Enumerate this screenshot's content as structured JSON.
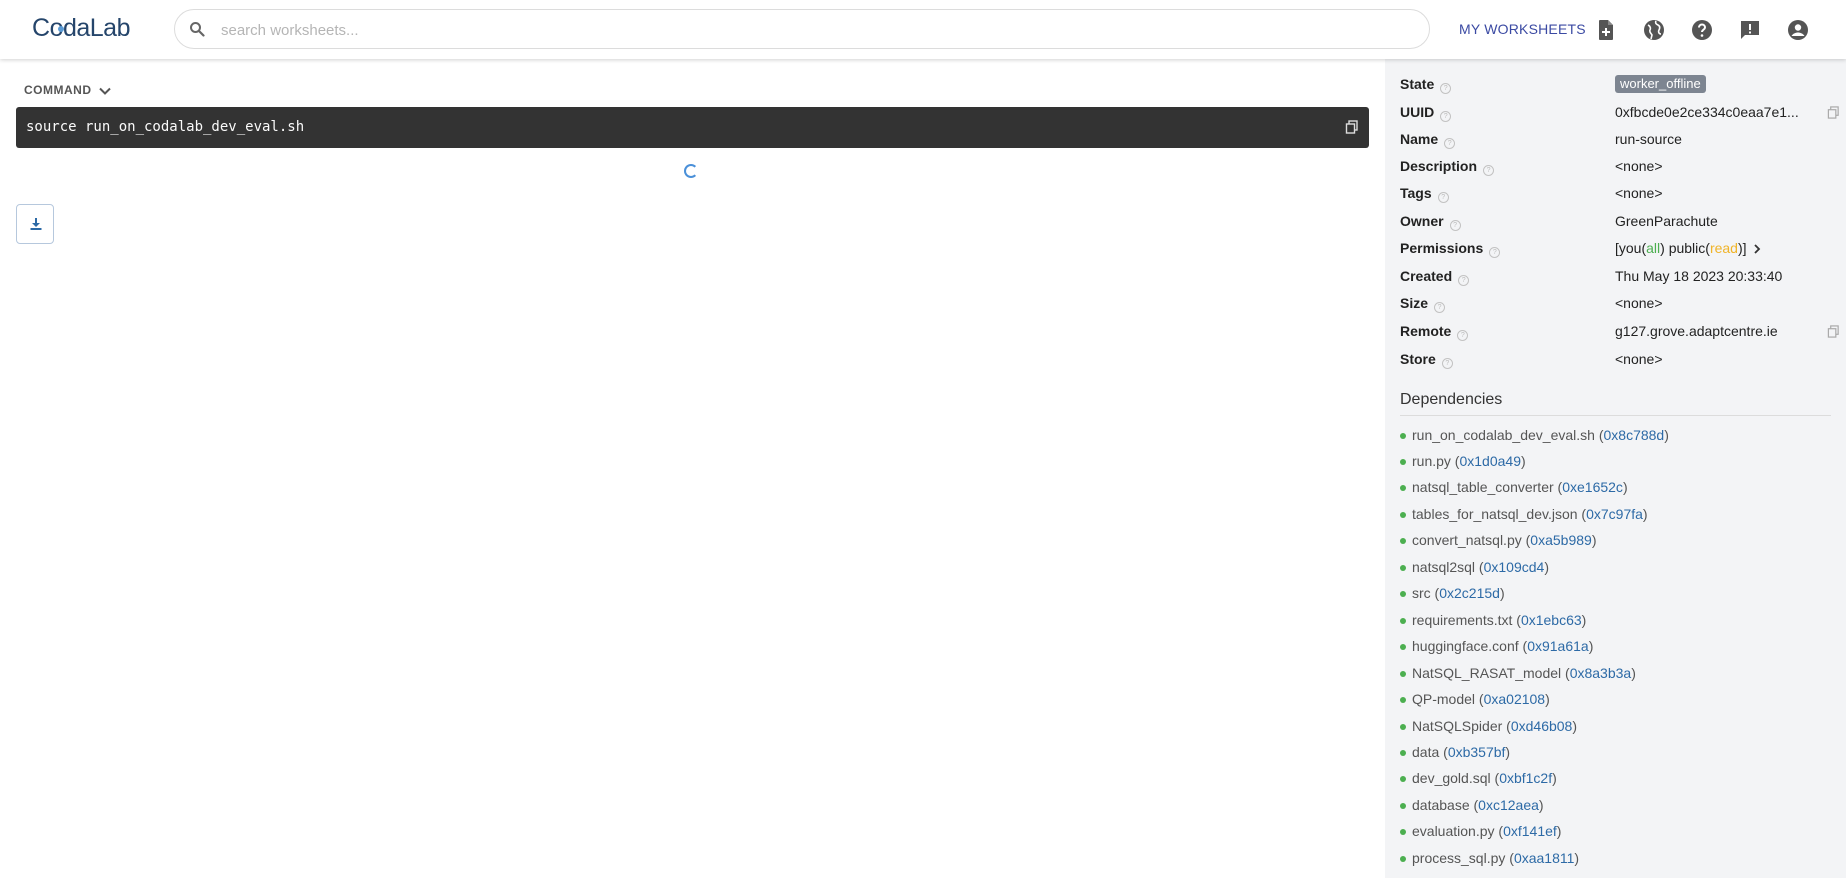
{
  "header": {
    "logo": "CodaLab",
    "search_placeholder": "search worksheets...",
    "my_worksheets": "MY WORKSHEETS",
    "icons": [
      "new-worksheet-icon",
      "globe-icon",
      "help-icon",
      "feedback-icon",
      "account-icon"
    ]
  },
  "main": {
    "command_label": "COMMAND",
    "command": "source run_on_codalab_dev_eval.sh"
  },
  "side": {
    "fields": {
      "state": {
        "label": "State",
        "value": "worker_offline"
      },
      "uuid": {
        "label": "UUID",
        "value": "0xfbcde0e2ce334c0eaa7e1..."
      },
      "name": {
        "label": "Name",
        "value": "run-source"
      },
      "description": {
        "label": "Description",
        "value": "<none>"
      },
      "tags": {
        "label": "Tags",
        "value": "<none>"
      },
      "owner": {
        "label": "Owner",
        "value": "GreenParachute"
      },
      "permissions": {
        "label": "Permissions",
        "p1": "[you(",
        "all": "all",
        "p2": ") public(",
        "read": "read",
        "p3": ")]"
      },
      "created": {
        "label": "Created",
        "value": "Thu May 18 2023 20:33:40"
      },
      "size": {
        "label": "Size",
        "value": "<none>"
      },
      "remote": {
        "label": "Remote",
        "value": "g127.grove.adaptcentre.ie"
      },
      "store": {
        "label": "Store",
        "value": "<none>"
      }
    },
    "dependencies_title": "Dependencies",
    "dependencies": [
      {
        "name": "run_on_codalab_dev_eval.sh",
        "uuid": "0x8c788d"
      },
      {
        "name": "run.py",
        "uuid": "0x1d0a49"
      },
      {
        "name": "natsql_table_converter",
        "uuid": "0xe1652c"
      },
      {
        "name": "tables_for_natsql_dev.json",
        "uuid": "0x7c97fa"
      },
      {
        "name": "convert_natsql.py",
        "uuid": "0xa5b989"
      },
      {
        "name": "natsql2sql",
        "uuid": "0x109cd4"
      },
      {
        "name": "src",
        "uuid": "0x2c215d"
      },
      {
        "name": "requirements.txt",
        "uuid": "0x1ebc63"
      },
      {
        "name": "huggingface.conf",
        "uuid": "0x91a61a"
      },
      {
        "name": "NatSQL_RASAT_model",
        "uuid": "0x8a3b3a"
      },
      {
        "name": "QP-model",
        "uuid": "0xa02108"
      },
      {
        "name": "NatSQLSpider",
        "uuid": "0xd46b08"
      },
      {
        "name": "data",
        "uuid": "0xb357bf"
      },
      {
        "name": "dev_gold.sql",
        "uuid": "0xbf1c2f"
      },
      {
        "name": "database",
        "uuid": "0xc12aea"
      },
      {
        "name": "evaluation.py",
        "uuid": "0xf141ef"
      },
      {
        "name": "process_sql.py",
        "uuid": "0xaa1811"
      }
    ]
  }
}
